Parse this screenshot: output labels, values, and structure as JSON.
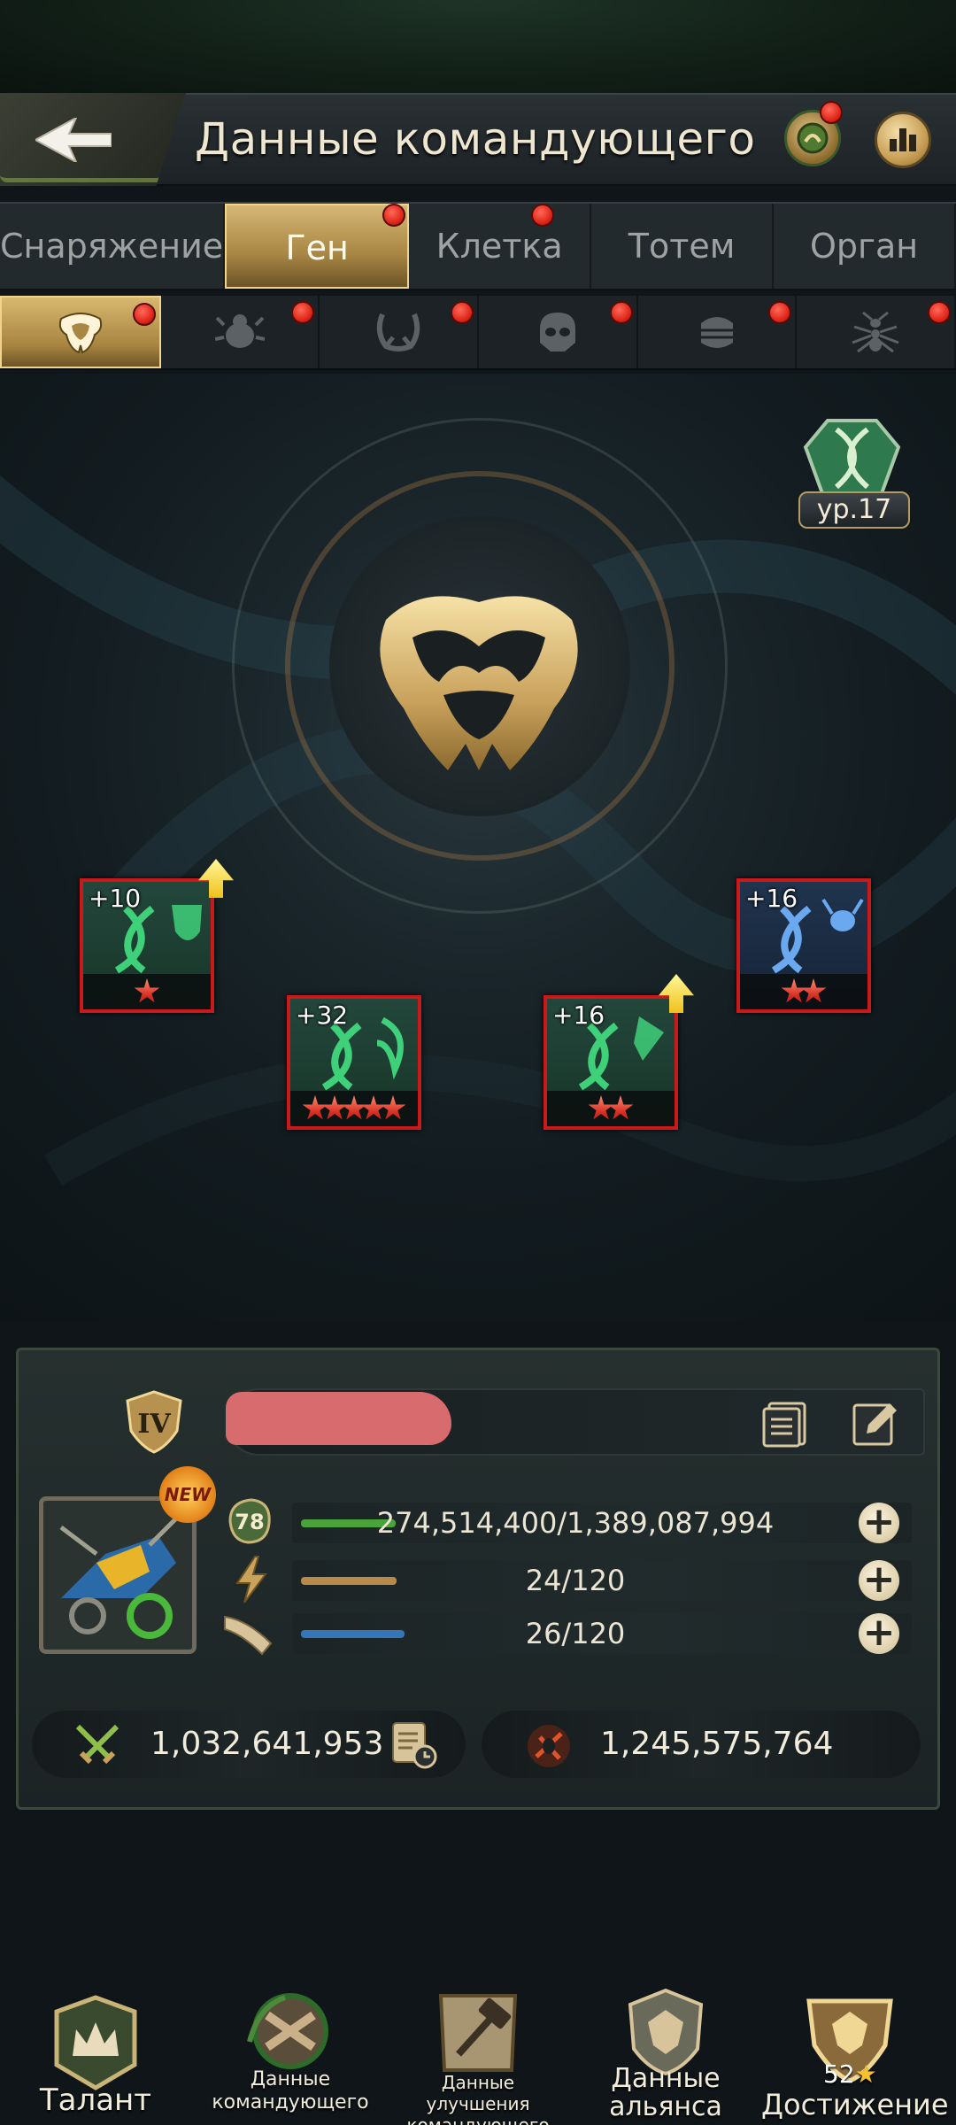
{
  "header": {
    "title": "Данные командующего"
  },
  "main_tabs": [
    {
      "label": "Снаряжение",
      "active": false,
      "badge": false
    },
    {
      "label": "Ген",
      "active": true,
      "badge": true
    },
    {
      "label": "Клетка",
      "active": false,
      "badge": true
    },
    {
      "label": "Тотем",
      "active": false,
      "badge": false
    },
    {
      "label": "Орган",
      "active": false,
      "badge": false
    }
  ],
  "sub_tabs": [
    {
      "icon": "horned-mask-icon",
      "active": true,
      "badge": true
    },
    {
      "icon": "beetle-icon",
      "active": false,
      "badge": true
    },
    {
      "icon": "claws-icon",
      "active": false,
      "badge": true
    },
    {
      "icon": "skull-helmet-icon",
      "active": false,
      "badge": true
    },
    {
      "icon": "armor-shell-icon",
      "active": false,
      "badge": true
    },
    {
      "icon": "ant-icon",
      "active": false,
      "badge": true
    }
  ],
  "gene_level": "ур.17",
  "genes": [
    {
      "level": "+10",
      "stars": 1,
      "color": "green",
      "upgradable": true
    },
    {
      "level": "+32",
      "stars": 5,
      "color": "green",
      "upgradable": false
    },
    {
      "level": "+16",
      "stars": 2,
      "color": "green",
      "upgradable": true
    },
    {
      "level": "+16",
      "stars": 2,
      "color": "blue",
      "upgradable": false
    }
  ],
  "commander": {
    "rank": "IV",
    "new_badge": "NEW",
    "level": "78",
    "experience": {
      "text": "274,514,400/1,389,087,994",
      "fraction": 0.198
    },
    "energy": {
      "text": "24/120",
      "fraction": 0.2
    },
    "stamina": {
      "text": "26/120",
      "fraction": 0.217
    },
    "power": "1,032,641,953",
    "kills": "1,245,575,764"
  },
  "bottom_nav": [
    {
      "label": "Талант",
      "icon": "talent-crown-icon"
    },
    {
      "label": "Данные командующего",
      "icon": "commander-data-icon"
    },
    {
      "label": "Данные улучшения командующего",
      "icon": "hammer-scroll-icon"
    },
    {
      "label": "Данные альянса",
      "icon": "alliance-crest-icon"
    },
    {
      "label": "Достижение",
      "icon": "achievement-trophy-icon",
      "count": "52"
    }
  ],
  "colors": {
    "accent_gold": "#d6b774",
    "badge_red": "#e0281b",
    "exp_bar": "#4aa33a",
    "energy_bar": "#b88a4a",
    "stamina_bar": "#3576b8",
    "star_red": "#d3291e"
  }
}
